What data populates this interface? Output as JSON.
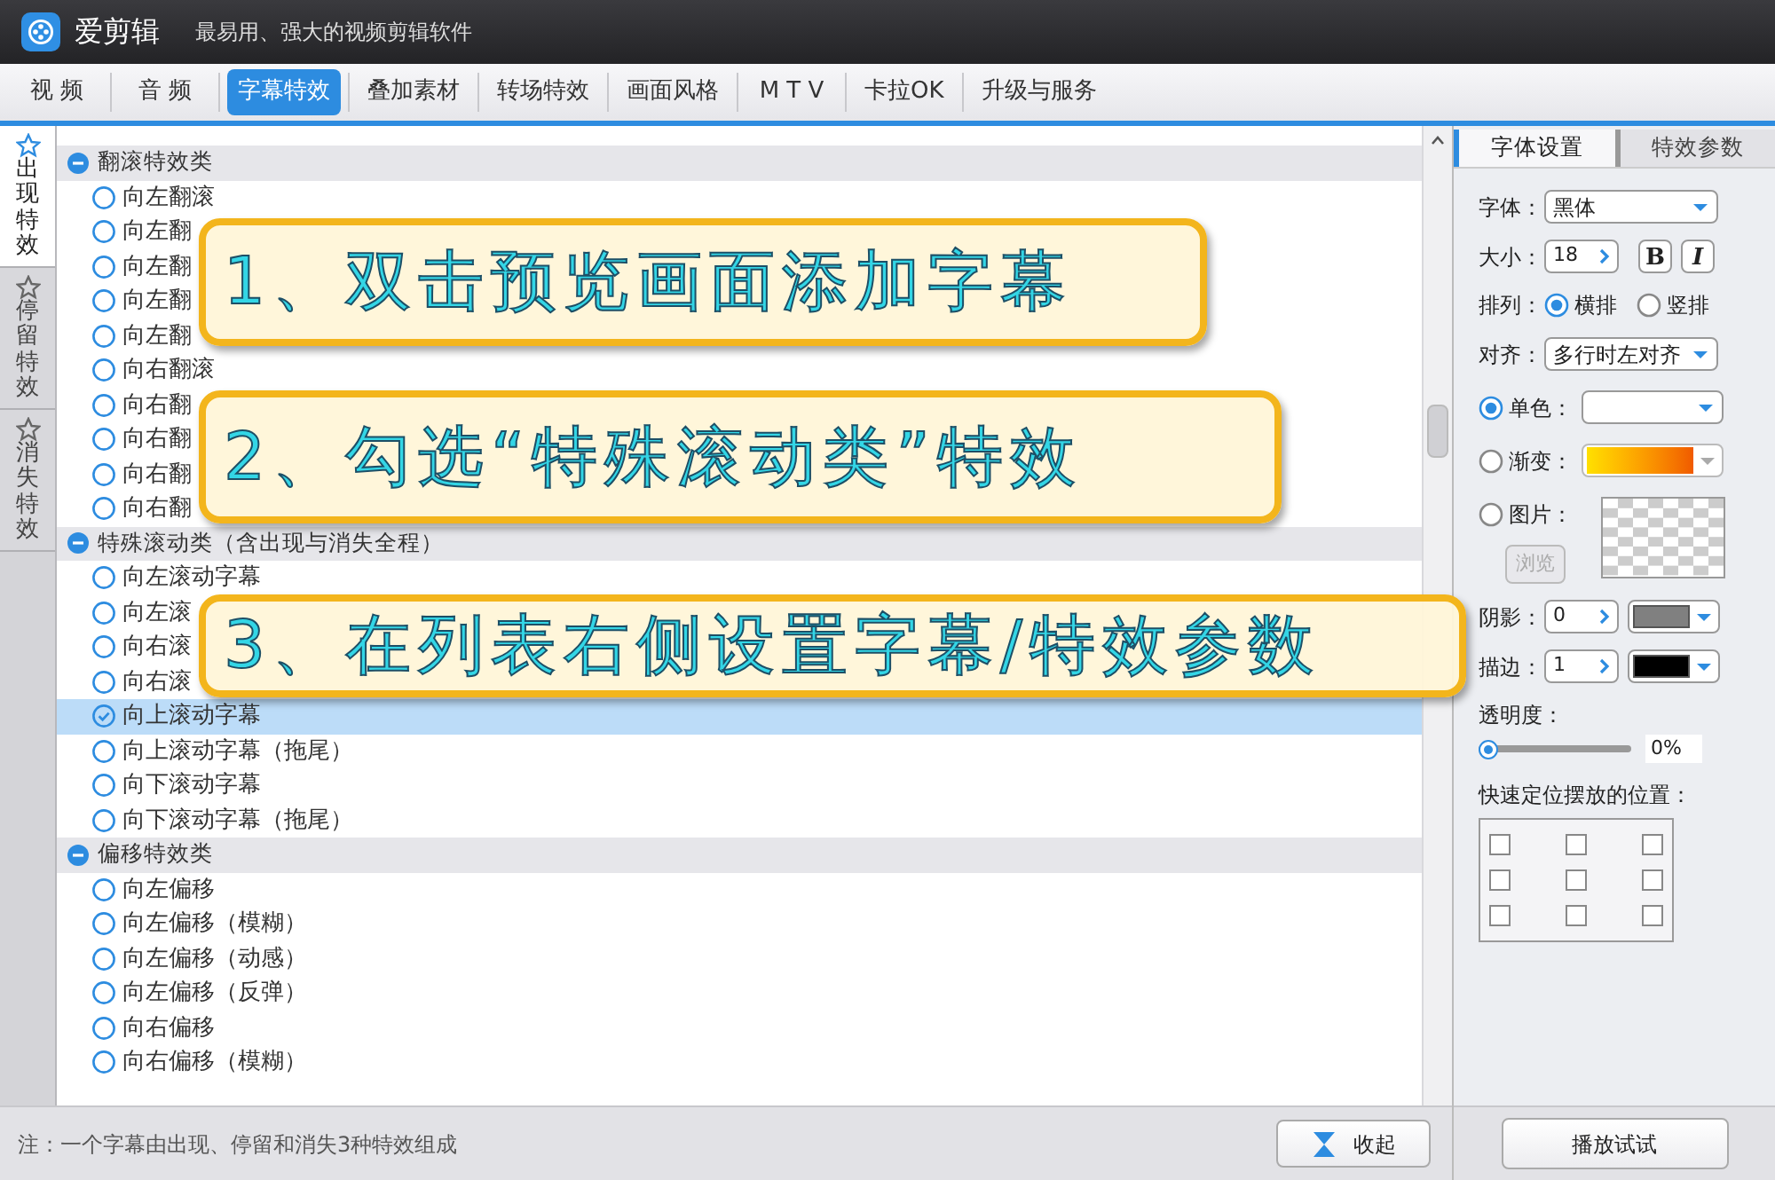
{
  "app": {
    "name": "爱剪辑",
    "tagline": "最易用、强大的视频剪辑软件"
  },
  "tabs": [
    {
      "label": "视 频",
      "selected": false
    },
    {
      "label": "音 频",
      "selected": false
    },
    {
      "label": "字幕特效",
      "selected": true
    },
    {
      "label": "叠加素材",
      "selected": false
    },
    {
      "label": "转场特效",
      "selected": false
    },
    {
      "label": "画面风格",
      "selected": false
    },
    {
      "label": "M T V",
      "selected": false
    },
    {
      "label": "卡拉OK",
      "selected": false
    },
    {
      "label": "升级与服务",
      "selected": false
    }
  ],
  "side_tabs": [
    {
      "label": "出现特效",
      "selected": true
    },
    {
      "label": "停留特效",
      "selected": false
    },
    {
      "label": "消失特效",
      "selected": false
    }
  ],
  "effect_groups": [
    {
      "label": "翻滚特效类",
      "expanded": true,
      "items": [
        {
          "label": "向左翻滚",
          "selected": false
        },
        {
          "label": "向左翻",
          "selected": false
        },
        {
          "label": "向左翻",
          "selected": false
        },
        {
          "label": "向左翻",
          "selected": false
        },
        {
          "label": "向左翻",
          "selected": false
        },
        {
          "label": "向右翻滚",
          "selected": false
        },
        {
          "label": "向右翻",
          "selected": false
        },
        {
          "label": "向右翻",
          "selected": false
        },
        {
          "label": "向右翻",
          "selected": false
        },
        {
          "label": "向右翻",
          "selected": false
        }
      ]
    },
    {
      "label": "特殊滚动类（含出现与消失全程）",
      "expanded": true,
      "items": [
        {
          "label": "向左滚动字幕",
          "selected": false
        },
        {
          "label": "向左滚",
          "selected": false
        },
        {
          "label": "向右滚",
          "selected": false
        },
        {
          "label": "向右滚",
          "selected": false
        },
        {
          "label": "向上滚动字幕",
          "selected": true
        },
        {
          "label": "向上滚动字幕（拖尾）",
          "selected": false
        },
        {
          "label": "向下滚动字幕",
          "selected": false
        },
        {
          "label": "向下滚动字幕（拖尾）",
          "selected": false
        }
      ]
    },
    {
      "label": "偏移特效类",
      "expanded": true,
      "items": [
        {
          "label": "向左偏移",
          "selected": false
        },
        {
          "label": "向左偏移（模糊）",
          "selected": false
        },
        {
          "label": "向左偏移（动感）",
          "selected": false
        },
        {
          "label": "向左偏移（反弹）",
          "selected": false
        },
        {
          "label": "向右偏移",
          "selected": false
        },
        {
          "label": "向右偏移（模糊）",
          "selected": false
        }
      ]
    }
  ],
  "callouts": [
    "1、双击预览画面添加字幕",
    "2、勾选“特殊滚动类”特效",
    "3、在列表右侧设置字幕/特效参数"
  ],
  "status_note": "注：一个字幕由出现、停留和消失3种特效组成",
  "collapse_button": "收起",
  "settings": {
    "tabs": [
      {
        "label": "字体设置",
        "selected": true
      },
      {
        "label": "特效参数",
        "selected": false
      }
    ],
    "font": {
      "label": "字体：",
      "value": "黑体"
    },
    "size": {
      "label": "大小：",
      "value": "18",
      "bold": "B",
      "italic": "I"
    },
    "layout": {
      "label": "排列：",
      "options": [
        {
          "label": "横排",
          "selected": true
        },
        {
          "label": "竖排",
          "selected": false
        }
      ]
    },
    "align": {
      "label": "对齐：",
      "value": "多行时左对齐"
    },
    "fill": [
      {
        "kind": "solid",
        "label": "单色：",
        "selected": true
      },
      {
        "kind": "gradient",
        "label": "渐变：",
        "selected": false
      },
      {
        "kind": "image",
        "label": "图片：",
        "selected": false,
        "button": "浏览"
      }
    ],
    "shadow": {
      "label": "阴影：",
      "value": "0",
      "color": "#808080"
    },
    "stroke": {
      "label": "描边：",
      "value": "1",
      "color": "#000000"
    },
    "opacity": {
      "label": "透明度：",
      "level": 0,
      "reading": "0%"
    },
    "position": {
      "label": "快速定位摆放的位置：",
      "cells": [
        {
          "checked": false
        },
        {
          "checked": false
        },
        {
          "checked": false
        },
        {
          "checked": false
        },
        {
          "checked": false
        },
        {
          "checked": false
        },
        {
          "checked": false
        },
        {
          "checked": false
        },
        {
          "checked": false
        }
      ]
    }
  },
  "play_button": "播放试试"
}
